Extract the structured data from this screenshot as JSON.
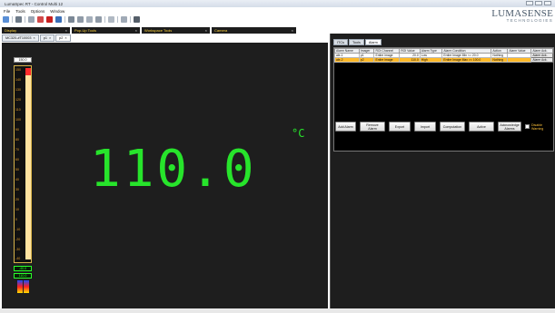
{
  "app": {
    "title": "LumaSpec RT - Control Multi 12",
    "logo_line1": "LUMASENSE",
    "logo_line2": "TECHNOLOGIES"
  },
  "menu": [
    "File",
    "Tools",
    "Options",
    "Window"
  ],
  "panels": {
    "display": "Display",
    "popup_tools": "Pop-Up Tools",
    "workspace_tools": "Workspace Tools",
    "camera": "Camera"
  },
  "doc_tabs": [
    {
      "label": "MC320-#T10003"
    },
    {
      "label": "p1"
    },
    {
      "label": "p2"
    }
  ],
  "scale": {
    "top_label": "150.0",
    "ticks": [
      "150",
      "140",
      "130",
      "120",
      "110",
      "100",
      "90",
      "80",
      "70",
      "60",
      "50",
      "40",
      "30",
      "20",
      "10",
      "0",
      "-10",
      "-20",
      "-30",
      "-40"
    ],
    "min_label": "-40.0",
    "value_label": "110.0"
  },
  "readout": {
    "value": "110.0",
    "unit": "°C",
    "color": "#27e42b"
  },
  "right_tabs": [
    {
      "label": "ITCs"
    },
    {
      "label": "Tools"
    },
    {
      "label": "Alarm"
    }
  ],
  "alarm_table": {
    "headers": [
      "Alarm Name",
      "Imager",
      "ROI Channel",
      "ROI Value",
      "Alarm Type",
      "Alarm Condition",
      "Action",
      "Alarm Value",
      "Alarm Ack."
    ],
    "rows": [
      {
        "name": "ale-1",
        "imager": "p1",
        "channel": "Entire image",
        "value": "20.0",
        "type": "Low",
        "condition": "Entire Image Min <= 20.0",
        "action": "Nothing",
        "alarm_value": "",
        "ack": "Alarm Ack."
      },
      {
        "name": "ale-2",
        "imager": "p2",
        "channel": "Entire image",
        "value": "110.0",
        "type": "High",
        "condition": "Entire Image Max >= 100.0",
        "action": "Nothing",
        "alarm_value": "",
        "ack": "Alarm Ack."
      }
    ]
  },
  "alarm_buttons": {
    "add": "Add Alarm",
    "remove": "Remove Alarm",
    "export": "Export",
    "import": "Import",
    "computation": "Computation",
    "active": "Active",
    "acknowledge": "Acknowledge Alarms",
    "disable_warning": "Disable Warning"
  }
}
